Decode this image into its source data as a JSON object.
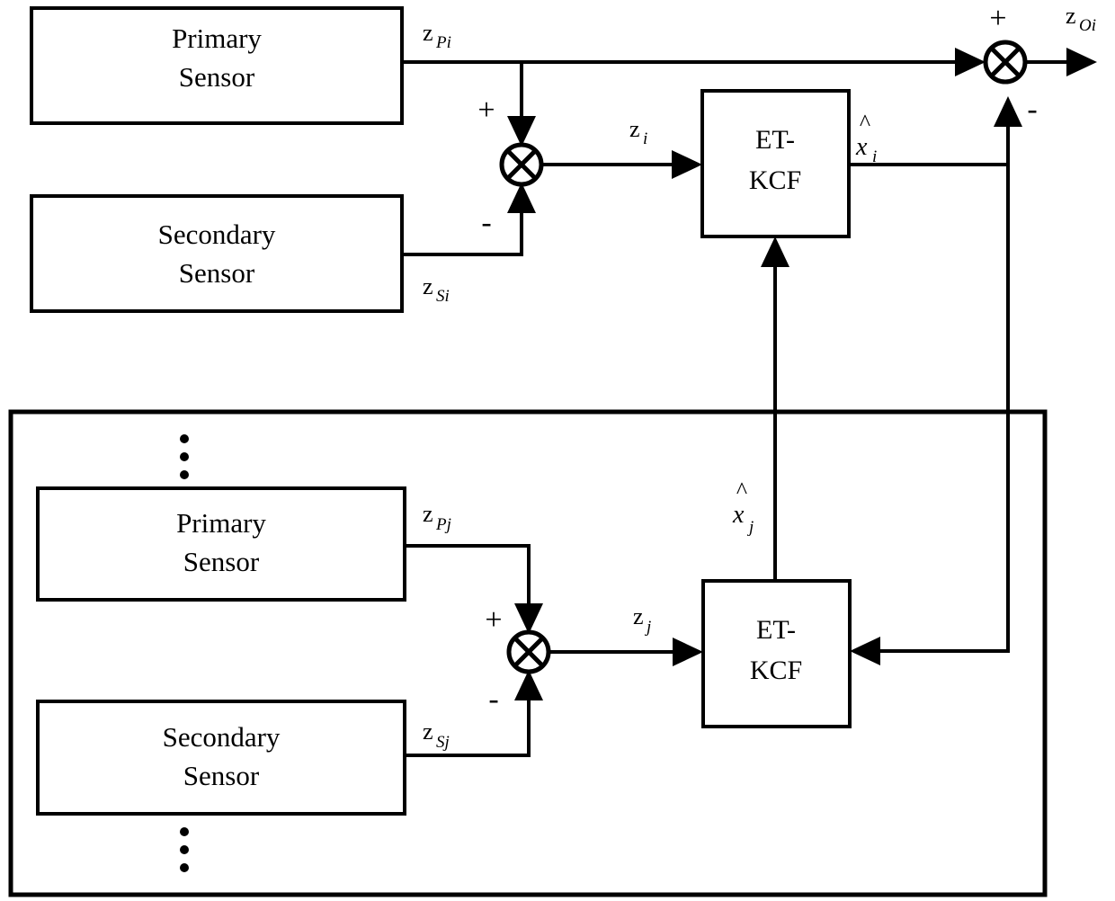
{
  "diagram": {
    "type": "block-diagram",
    "title": "Event-Triggered Kalman Consensus Filter multi-sensor fusion block diagram",
    "background_color": "#ffffff",
    "line_color": "#000000",
    "blocks": [
      {
        "id": "primary_sensor_i",
        "line1": "Primary",
        "line2": "Sensor"
      },
      {
        "id": "secondary_sensor_i",
        "line1": "Secondary",
        "line2": "Sensor"
      },
      {
        "id": "primary_sensor_j",
        "line1": "Primary",
        "line2": "Sensor"
      },
      {
        "id": "secondary_sensor_j",
        "line1": "Secondary",
        "line2": "Sensor"
      },
      {
        "id": "et_kcf_i",
        "line1": "ET-",
        "line2": "KCF"
      },
      {
        "id": "et_kcf_j",
        "line1": "ET-",
        "line2": "KCF"
      }
    ],
    "signals": {
      "z_pi": {
        "base": "z",
        "sub": "Pi"
      },
      "z_si": {
        "base": "z",
        "sub": "Si"
      },
      "z_i": {
        "base": "z",
        "sub": "i"
      },
      "x_hat_i": {
        "base": "x",
        "sub": "i",
        "accent": "^"
      },
      "z_oi": {
        "base": "z",
        "sub": "Oi"
      },
      "z_pj": {
        "base": "z",
        "sub": "Pj"
      },
      "z_sj": {
        "base": "z",
        "sub": "Sj"
      },
      "z_j": {
        "base": "z",
        "sub": "j"
      },
      "x_hat_j": {
        "base": "x",
        "sub": "j",
        "accent": "^"
      }
    },
    "signs": {
      "sum_i_plus": "+",
      "sum_i_minus": "-",
      "sum_out_plus": "+",
      "sum_out_minus": "-",
      "sum_j_plus": "+",
      "sum_j_minus": "-"
    },
    "ellipsis": {
      "above_label": "vertical-ellipsis",
      "below_label": "vertical-ellipsis",
      "dot_count": 3
    },
    "summing_junctions": [
      {
        "id": "sum_i",
        "symbol": "cross-circle"
      },
      {
        "id": "sum_out",
        "symbol": "cross-circle"
      },
      {
        "id": "sum_j",
        "symbol": "cross-circle"
      }
    ]
  }
}
